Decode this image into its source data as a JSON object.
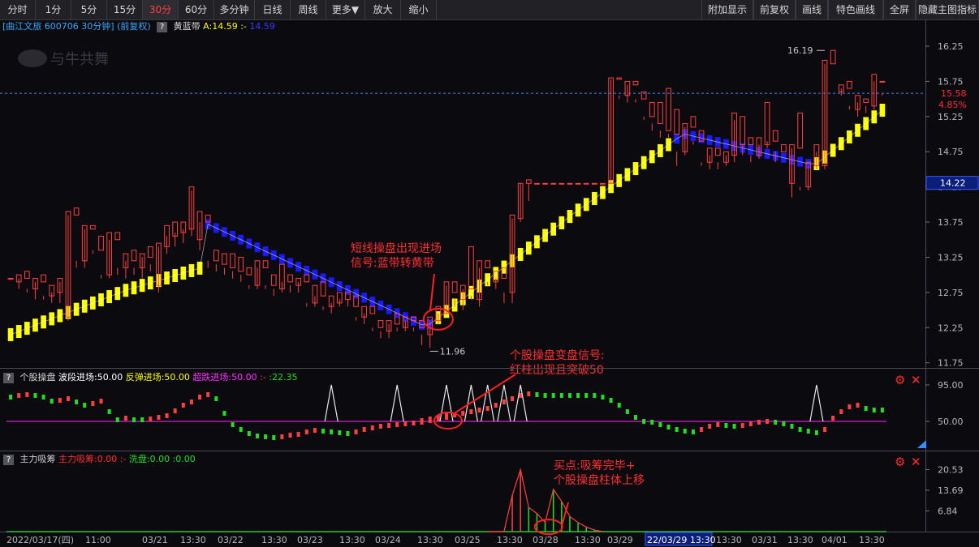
{
  "toolbar": {
    "left": [
      {
        "label": "分时"
      },
      {
        "label": "1分"
      },
      {
        "label": "5分"
      },
      {
        "label": "15分"
      },
      {
        "label": "30分",
        "active": true
      },
      {
        "label": "60分"
      },
      {
        "label": "多分钟"
      },
      {
        "label": "日线"
      },
      {
        "label": "周线"
      },
      {
        "label": "更多▼"
      },
      {
        "label": "放大"
      },
      {
        "label": "缩小"
      }
    ],
    "right": [
      {
        "label": "附加显示"
      },
      {
        "label": "前复权"
      },
      {
        "label": "画线"
      },
      {
        "label": "特色画线"
      },
      {
        "label": "全屏"
      },
      {
        "label": "隐藏主图指标"
      }
    ]
  },
  "info": {
    "stock": "[曲江文旅 600706 30分钟]",
    "adjust": "(前复权)",
    "help": "?",
    "indicator": "黄蓝带",
    "value_label": "A:14.59",
    "sep": ":-",
    "value2": "14.59"
  },
  "watermark": "与牛共舞",
  "price_axis": {
    "ticks": [
      "16.25",
      "15.75",
      "15.25",
      "14.75",
      "14.25",
      "13.75",
      "13.25",
      "12.75",
      "12.25",
      "11.75"
    ],
    "current_price": "15.58",
    "current_pct": "4.85%",
    "cursor_price": "14.22",
    "high_label": "16.19",
    "low_label": "11.96"
  },
  "colors": {
    "up": "#ff4040",
    "down": "#00e5ee",
    "yellow_band": "#ffff00",
    "blue_band": "#1a1aff",
    "green": "#22dd22",
    "magenta": "#d020d0",
    "background": "#0b0b0f"
  },
  "panel2": {
    "help": "?",
    "name": "个股操盘",
    "l1": "波段进场:50.00",
    "l2": "反弹进场:50.00",
    "l3": "超跌进场:50.00",
    "l4": ":-",
    "l5": ":22.35",
    "ticks": [
      "95.00",
      "50.00"
    ]
  },
  "panel3": {
    "help": "?",
    "name": "主力吸筹",
    "l1": "主力吸筹:0.00",
    "l2": ":-",
    "l3": "洗盘:0.00",
    "l4": ":0.00",
    "ticks": [
      "20.53",
      "13.69",
      "6.84"
    ]
  },
  "time_axis": {
    "labels": [
      "2022/03/17(四)",
      "11:00",
      "03/21",
      "13:30",
      "03/22",
      "13:30",
      "03/23",
      "13:30",
      "03/24",
      "13:30",
      "03/25",
      "13:30",
      "03/28",
      "13:30",
      "03/29",
      "13:30",
      "03/30",
      "13:30",
      "03/31",
      "13:30",
      "04/01",
      "13:30"
    ],
    "cursor": "22/03/29 13:30"
  },
  "annotations": {
    "a1_l1": "短线操盘出现进场",
    "a1_l2": "信号:蓝带转黄带",
    "a2_l1": "个股操盘变盘信号:",
    "a2_l2": "红柱出现且突破50",
    "a3_l1": "买点:吸筹完毕+",
    "a3_l2": "个股操盘柱体上移"
  },
  "chart_data": {
    "type": "candlestick",
    "timeframe": "30分",
    "ylim": [
      11.7,
      16.4
    ],
    "candles": [
      [
        12.95,
        12.95,
        12.95,
        12.95
      ],
      [
        12.9,
        13.0,
        12.8,
        12.95
      ],
      [
        12.95,
        13.05,
        12.75,
        12.8
      ],
      [
        12.8,
        12.95,
        12.65,
        12.9
      ],
      [
        12.9,
        13.0,
        12.65,
        12.7
      ],
      [
        12.7,
        12.85,
        12.6,
        12.75
      ],
      [
        12.75,
        12.95,
        12.6,
        12.9
      ],
      [
        12.4,
        13.9,
        12.35,
        13.85
      ],
      [
        13.85,
        13.95,
        13.1,
        13.2
      ],
      [
        13.2,
        13.7,
        13.1,
        13.65
      ],
      [
        13.65,
        13.7,
        13.3,
        13.35
      ],
      [
        13.35,
        13.55,
        12.95,
        13.0
      ],
      [
        13.0,
        13.6,
        12.95,
        13.5
      ],
      [
        13.5,
        13.6,
        13.0,
        13.1
      ],
      [
        13.1,
        13.3,
        12.95,
        13.2
      ],
      [
        13.2,
        13.35,
        13.0,
        13.1
      ],
      [
        13.1,
        13.3,
        12.95,
        13.25
      ],
      [
        13.25,
        13.4,
        13.05,
        13.15
      ],
      [
        12.85,
        13.45,
        12.75,
        13.4
      ],
      [
        13.4,
        13.7,
        13.3,
        13.55
      ],
      [
        13.55,
        13.75,
        13.4,
        13.6
      ],
      [
        13.6,
        13.75,
        13.45,
        13.65
      ],
      [
        13.65,
        14.25,
        13.55,
        14.2
      ],
      [
        13.5,
        13.9,
        13.35,
        13.75
      ],
      [
        13.75,
        13.85,
        13.1,
        13.2
      ],
      [
        13.2,
        13.35,
        13.05,
        13.15
      ],
      [
        13.15,
        13.3,
        13.0,
        13.1
      ],
      [
        13.1,
        13.3,
        12.95,
        13.05
      ],
      [
        13.05,
        13.25,
        12.9,
        13.0
      ],
      [
        13.0,
        13.1,
        12.8,
        12.85
      ],
      [
        12.85,
        13.2,
        12.8,
        13.1
      ],
      [
        13.1,
        13.2,
        12.8,
        12.85
      ],
      [
        12.85,
        13.0,
        12.7,
        12.8
      ],
      [
        12.8,
        13.15,
        12.75,
        12.9
      ],
      [
        12.9,
        13.0,
        12.75,
        12.85
      ],
      [
        12.85,
        12.95,
        12.75,
        12.9
      ],
      [
        12.9,
        13.0,
        12.55,
        12.6
      ],
      [
        12.6,
        12.85,
        12.55,
        12.7
      ],
      [
        12.7,
        12.9,
        12.5,
        12.55
      ],
      [
        12.55,
        12.7,
        12.45,
        12.6
      ],
      [
        12.6,
        12.75,
        12.55,
        12.65
      ],
      [
        12.65,
        12.75,
        12.55,
        12.65
      ],
      [
        12.55,
        12.7,
        12.35,
        12.4
      ],
      [
        12.4,
        12.55,
        12.3,
        12.45
      ],
      [
        12.45,
        12.55,
        12.2,
        12.25
      ],
      [
        12.25,
        12.35,
        12.1,
        12.2
      ],
      [
        12.2,
        12.35,
        12.1,
        12.3
      ],
      [
        12.3,
        12.45,
        12.2,
        12.25
      ],
      [
        12.25,
        12.4,
        12.2,
        12.35
      ],
      [
        12.35,
        12.4,
        12.2,
        12.25
      ],
      [
        12.25,
        12.35,
        12.0,
        12.15
      ],
      [
        12.15,
        12.4,
        11.96,
        12.35
      ],
      [
        12.35,
        12.55,
        12.3,
        12.45
      ],
      [
        12.45,
        12.9,
        12.45,
        12.85
      ],
      [
        12.75,
        12.9,
        12.55,
        12.65
      ],
      [
        12.65,
        12.85,
        12.5,
        12.8
      ],
      [
        12.8,
        13.4,
        12.7,
        12.65
      ],
      [
        12.65,
        13.2,
        12.55,
        13.1
      ],
      [
        13.1,
        13.2,
        12.85,
        12.9
      ],
      [
        12.9,
        13.05,
        12.8,
        12.95
      ],
      [
        12.95,
        13.1,
        12.6,
        12.75
      ],
      [
        12.75,
        13.85,
        12.6,
        13.8
      ],
      [
        13.8,
        14.3,
        13.75,
        14.3
      ],
      [
        14.3,
        14.35,
        14.05,
        14.3
      ],
      [
        14.3,
        14.3,
        14.3,
        14.3
      ],
      [
        14.3,
        14.3,
        14.3,
        14.3
      ],
      [
        14.3,
        14.3,
        14.3,
        14.3
      ],
      [
        14.3,
        14.3,
        14.3,
        14.3
      ],
      [
        14.3,
        14.3,
        14.3,
        14.3
      ],
      [
        14.3,
        14.3,
        14.3,
        14.3
      ],
      [
        14.3,
        14.3,
        14.3,
        14.3
      ],
      [
        14.3,
        14.3,
        14.3,
        14.3
      ],
      [
        14.3,
        14.3,
        14.3,
        14.3
      ],
      [
        14.3,
        15.8,
        14.3,
        15.78
      ],
      [
        15.78,
        15.8,
        15.5,
        15.55
      ],
      [
        15.55,
        15.75,
        15.45,
        15.7
      ],
      [
        15.7,
        15.75,
        15.45,
        15.5
      ],
      [
        15.5,
        15.6,
        15.2,
        15.25
      ],
      [
        15.25,
        15.45,
        15.05,
        15.15
      ],
      [
        15.15,
        15.45,
        14.95,
        15.05
      ],
      [
        15.05,
        15.65,
        14.95,
        15.0
      ],
      [
        15.0,
        15.35,
        14.55,
        14.75
      ],
      [
        14.75,
        15.15,
        14.7,
        15.1
      ],
      [
        15.1,
        15.25,
        14.85,
        14.9
      ],
      [
        14.9,
        15.05,
        14.55,
        14.6
      ],
      [
        14.6,
        14.8,
        14.5,
        14.7
      ],
      [
        14.7,
        14.8,
        14.5,
        14.6
      ],
      [
        14.6,
        14.75,
        14.55,
        14.7
      ],
      [
        14.7,
        15.3,
        14.6,
        15.2
      ],
      [
        14.85,
        15.25,
        14.7,
        14.85
      ],
      [
        14.85,
        14.95,
        14.6,
        14.7
      ],
      [
        14.7,
        14.95,
        14.65,
        14.85
      ],
      [
        14.85,
        15.45,
        14.8,
        14.9
      ],
      [
        14.9,
        15.05,
        14.6,
        14.75
      ],
      [
        14.75,
        14.85,
        14.3,
        14.3
      ],
      [
        14.3,
        14.85,
        14.1,
        14.8
      ],
      [
        14.8,
        15.3,
        14.2,
        14.25
      ],
      [
        14.25,
        14.6,
        14.2,
        14.55
      ],
      [
        14.55,
        14.85,
        14.5,
        14.75
      ],
      [
        14.55,
        16.05,
        14.5,
        16.0
      ],
      [
        16.0,
        16.19,
        15.6,
        15.6
      ],
      [
        15.6,
        15.7,
        15.55,
        15.65
      ],
      [
        15.65,
        15.75,
        15.4,
        15.35
      ],
      [
        15.35,
        15.55,
        15.25,
        15.45
      ],
      [
        15.45,
        15.5,
        15.3,
        15.4
      ],
      [
        15.4,
        15.85,
        15.35,
        15.75
      ],
      [
        15.75,
        15.75,
        15.55,
        15.58
      ]
    ],
    "panel2_series": {
      "name": "个股操盘",
      "reference": 50,
      "values": [
        80,
        82,
        83,
        82,
        80,
        75,
        76,
        78,
        74,
        70,
        72,
        75,
        62,
        52,
        54,
        52,
        52,
        53,
        55,
        57,
        63,
        70,
        74,
        80,
        83,
        78,
        60,
        46,
        40,
        35,
        32,
        31,
        30,
        31,
        33,
        34,
        37,
        39,
        38,
        37,
        36,
        35,
        37,
        40,
        42,
        44,
        45,
        46,
        47,
        48,
        50,
        52,
        54,
        56,
        58,
        60,
        62,
        64,
        66,
        70,
        74,
        78,
        82,
        84,
        83,
        82,
        82,
        82,
        82,
        82,
        82,
        82,
        80,
        76,
        70,
        62,
        55,
        50,
        49,
        46,
        43,
        40,
        38,
        37,
        40,
        44,
        46,
        45,
        44,
        45,
        47,
        49,
        50,
        49,
        47,
        44,
        40,
        38,
        36,
        40,
        54,
        62,
        68,
        70,
        66,
        64,
        64,
        64
      ]
    },
    "panel3_series": {
      "name": "主力吸筹",
      "values": [
        0,
        0,
        0,
        0,
        0,
        0,
        0,
        0,
        0,
        0,
        0,
        0,
        0,
        0,
        0,
        0,
        0,
        0,
        0,
        0,
        0,
        0,
        0,
        0,
        0,
        0,
        0,
        0,
        0,
        0,
        0,
        0,
        0,
        0,
        0,
        0,
        0,
        0,
        0,
        0,
        0,
        0,
        0,
        0,
        0,
        0,
        0,
        0,
        0,
        0,
        0,
        0,
        0,
        0,
        0,
        0,
        0,
        0,
        0,
        0,
        0,
        12,
        20.53,
        8,
        6,
        3,
        14,
        10,
        5,
        3,
        1.5,
        0.5,
        0,
        0,
        0,
        0,
        0,
        0,
        0,
        0,
        0,
        0,
        0,
        0,
        0,
        0,
        0,
        0,
        0,
        0,
        0,
        0,
        0,
        0,
        0,
        0,
        0,
        0,
        0,
        0,
        0,
        0,
        0,
        0,
        0,
        0,
        0,
        0
      ]
    }
  }
}
